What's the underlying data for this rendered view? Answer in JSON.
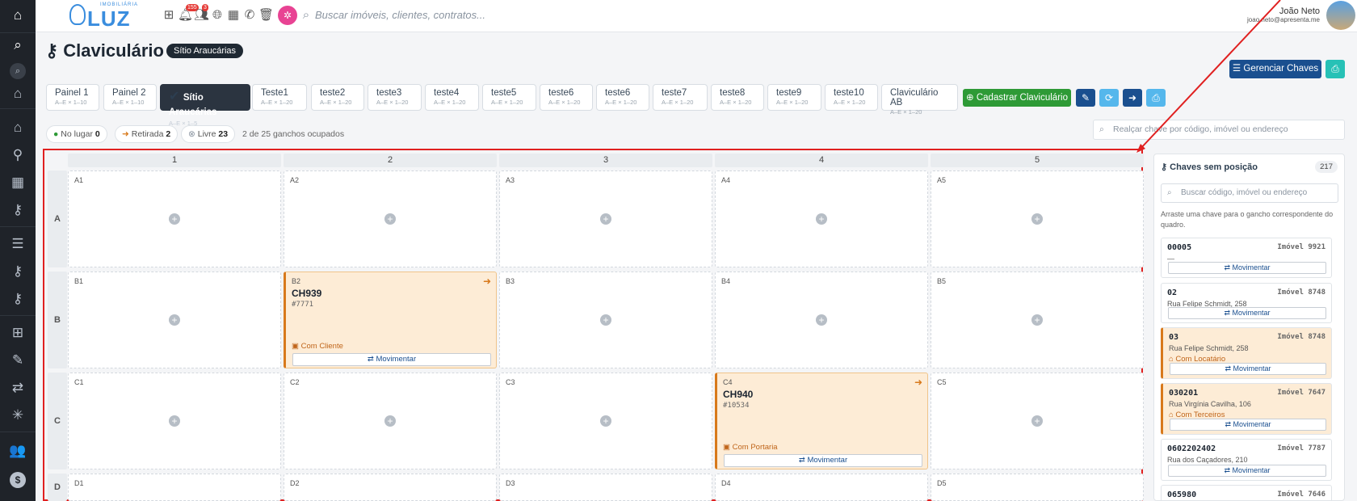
{
  "rail": {
    "icons": [
      "home-icon",
      "search-icon",
      "search-small-icon",
      "house-icon",
      "house-outline-icon",
      "map-pin-icon",
      "building-icon",
      "key-icon",
      "list-icon",
      "key2-icon",
      "key3-icon",
      "hierarchy-icon",
      "pen-icon",
      "transfer-icon",
      "network-icon",
      "people-icon",
      "money-icon"
    ]
  },
  "topbar": {
    "logo_sub": "IMOBILIÁRIA",
    "logo_text": "LUZ",
    "notif_count": "155",
    "people_count": "3",
    "search_placeholder": "Buscar imóveis, clientes, contratos...",
    "user_name": "João Neto",
    "user_email": "joao.neto@apresenta.me"
  },
  "page": {
    "title": "Claviculário",
    "badge": "Sítio Araucárias",
    "manage_label": "Gerenciar Chaves",
    "register_label": "Cadastrar Claviculário"
  },
  "tabs": [
    {
      "label": "Painel 1",
      "sub": "A–E × 1–10"
    },
    {
      "label": "Painel 2",
      "sub": "A–E × 1–10"
    },
    {
      "label": "Sítio Araucárias",
      "sub": "A–E × 1–5",
      "active": true
    },
    {
      "label": "Teste1",
      "sub": "A–E × 1–20"
    },
    {
      "label": "teste2",
      "sub": "A–E × 1–20"
    },
    {
      "label": "teste3",
      "sub": "A–E × 1–20"
    },
    {
      "label": "teste4",
      "sub": "A–E × 1–20"
    },
    {
      "label": "teste5",
      "sub": "A–E × 1–20"
    },
    {
      "label": "teste6",
      "sub": "A–E × 1–20"
    },
    {
      "label": "teste6",
      "sub": "A–E × 1–20"
    },
    {
      "label": "teste7",
      "sub": "A–E × 1–20"
    },
    {
      "label": "teste8",
      "sub": "A–E × 1–20"
    },
    {
      "label": "teste9",
      "sub": "A–E × 1–20"
    },
    {
      "label": "teste10",
      "sub": "A–E × 1–20"
    },
    {
      "label": "Claviculário AB",
      "sub": "A–E × 1–20"
    }
  ],
  "stats": {
    "in_place_label": "No lugar",
    "in_place": "0",
    "taken_label": "Retirada",
    "taken": "2",
    "free_label": "Livre",
    "free": "23",
    "occupied_text": "2 de 25 ganchos ocupados",
    "highlight_placeholder": "Realçar chave por código, imóvel ou endereço"
  },
  "grid": {
    "columns": [
      "1",
      "2",
      "3",
      "4",
      "5"
    ],
    "rows": [
      "A",
      "B",
      "C",
      "D"
    ],
    "cells": [
      [
        "A1",
        "A2",
        "A3",
        "A4",
        "A5"
      ],
      [
        "B1",
        "B2",
        "B3",
        "B4",
        "B5"
      ],
      [
        "C1",
        "C2",
        "C3",
        "C4",
        "C5"
      ],
      [
        "D1",
        "D2",
        "D3",
        "D4",
        "D5"
      ]
    ],
    "occupied": {
      "B2": {
        "code": "CH939",
        "imovel": "#7771",
        "status": "Com Cliente",
        "action": "Movimentar"
      },
      "C4": {
        "code": "CH940",
        "imovel": "#10534",
        "status": "Com Portaria",
        "action": "Movimentar"
      }
    }
  },
  "sidebar": {
    "title": "Chaves sem posição",
    "count": "217",
    "search_placeholder": "Buscar código, imóvel ou endereço",
    "help": "Arraste uma chave para o gancho correspondente do quadro.",
    "keys": [
      {
        "code": "00005",
        "imovel": "Imóvel 9921",
        "address": "—",
        "status": "",
        "action": "Movimentar"
      },
      {
        "code": "02",
        "imovel": "Imóvel 8748",
        "address": "Rua Felipe Schmidt, 258",
        "status": "",
        "action": "Movimentar"
      },
      {
        "code": "03",
        "imovel": "Imóvel 8748",
        "address": "Rua Felipe Schmidt, 258",
        "status": "Com Locatário",
        "action": "Movimentar"
      },
      {
        "code": "030201",
        "imovel": "Imóvel 7647",
        "address": "Rua Virgínia Cavilha, 106",
        "status": "Com Terceiros",
        "action": "Movimentar"
      },
      {
        "code": "0602202402",
        "imovel": "Imóvel 7787",
        "address": "Rua dos Caçadores, 210",
        "status": "",
        "action": "Movimentar"
      },
      {
        "code": "065980",
        "imovel": "Imóvel 7646",
        "address": "",
        "status": "",
        "action": ""
      }
    ]
  }
}
